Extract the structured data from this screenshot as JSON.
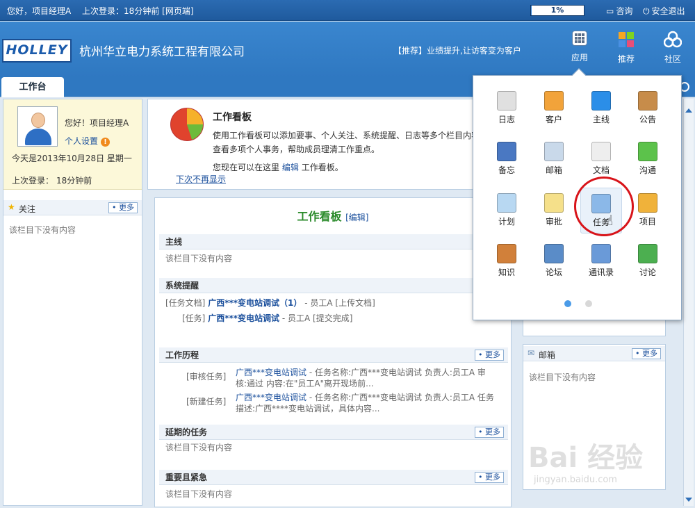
{
  "topbar": {
    "greeting": "您好，项目经理A",
    "last_login": "上次登录：18分钟前 [网页端]",
    "progress_text": "1%",
    "progress_value": 0.01,
    "consult": "咨询",
    "logout": "安全退出"
  },
  "header": {
    "logo": "HOLLEY",
    "company": "杭州华立电力系统工程有限公司",
    "promo": "【推荐】业绩提升,让访客变为客户",
    "nav": [
      {
        "label": "应用",
        "icon": "grid-icon"
      },
      {
        "label": "推荐",
        "icon": "recommend-icon"
      },
      {
        "label": "社区",
        "icon": "community-icon"
      }
    ]
  },
  "tabs": {
    "workbench": "工作台"
  },
  "user": {
    "hello": "您好！项目经理A",
    "settings": "个人设置",
    "settings_badge": "!",
    "today": "今天是2013年10月28日 星期一",
    "last_login_label": "上次登录：",
    "last_login_value": "18分钟前"
  },
  "follow": {
    "title": "关注",
    "more": "更多",
    "empty": "该栏目下没有内容"
  },
  "guide": {
    "title": "工作看板",
    "desc1": "使用工作看板可以添加要事、个人关注、系统提醒、日志等多个栏目内容，",
    "desc2": "查看多项个人事务，帮助成员理清工作重点。",
    "desc3_pre": "您现在可以在这里",
    "desc3_link": "编辑",
    "desc3_post": "工作看板。",
    "no_more": "下次不再显示"
  },
  "board": {
    "title": "工作看板",
    "edit": "[编辑]",
    "mainline": {
      "title": "主线",
      "empty": "该栏目下没有内容"
    },
    "reminders": {
      "title": "系统提醒",
      "items": [
        {
          "label": "[任务文档]",
          "link": "广西***变电站调试（1）",
          "note": "- 员工A [上传文档]"
        },
        {
          "label": "[任务]",
          "link": "广西***变电站调试",
          "note": "- 员工A [提交完成]"
        }
      ]
    },
    "history": {
      "title": "工作历程",
      "more": "更多",
      "items": [
        {
          "label": "[审核任务]",
          "link": "广西***变电站调试",
          "line1": "- 任务名称:广西***变电站调试 负责人:员工A 审",
          "line2": "核:通过 内容:在\"员工A\"离开现场前..."
        },
        {
          "label": "[新建任务]",
          "link": "广西***变电站调试",
          "line1": "- 任务名称:广西***变电站调试 负责人:员工A 任务",
          "line2": "描述:广西****变电站调试，具体内容..."
        }
      ]
    },
    "delayed": {
      "title": "延期的任务",
      "more": "更多",
      "empty": "该栏目下没有内容"
    },
    "urgent": {
      "title": "重要且紧急",
      "more": "更多",
      "empty": "该栏目下没有内容"
    }
  },
  "mailbox": {
    "title": "邮箱",
    "more": "更多",
    "empty": "该栏目下没有内容"
  },
  "apps": [
    {
      "label": "日志",
      "icon": "calendar-icon",
      "color": "#e0e0e0"
    },
    {
      "label": "客户",
      "icon": "customers-icon",
      "color": "#f2a33a"
    },
    {
      "label": "主线",
      "icon": "mainline-icon",
      "color": "#2b8ee8"
    },
    {
      "label": "公告",
      "icon": "clipboard-icon",
      "color": "#c78c4a"
    },
    {
      "label": "备忘",
      "icon": "notebook-icon",
      "color": "#4a78c2"
    },
    {
      "label": "邮箱",
      "icon": "mail-icon",
      "color": "#c9d9ea"
    },
    {
      "label": "文档",
      "icon": "document-icon",
      "color": "#eeeeee"
    },
    {
      "label": "沟通",
      "icon": "chat-icon",
      "color": "#5cc24b"
    },
    {
      "label": "计划",
      "icon": "plan-table-icon",
      "color": "#b8d8f2"
    },
    {
      "label": "审批",
      "icon": "approval-icon",
      "color": "#f5e08a"
    },
    {
      "label": "任务",
      "icon": "task-icon",
      "color": "#8bb8e8"
    },
    {
      "label": "项目",
      "icon": "gears-icon",
      "color": "#f0b23a"
    },
    {
      "label": "知识",
      "icon": "books-icon",
      "color": "#d1803a"
    },
    {
      "label": "论坛",
      "icon": "forum-icon",
      "color": "#5a8cc8"
    },
    {
      "label": "通讯录",
      "icon": "contacts-icon",
      "color": "#6a9ad8"
    },
    {
      "label": "讨论",
      "icon": "discuss-icon",
      "color": "#4caf50"
    }
  ],
  "watermark": {
    "main": "Bai 经验",
    "sub": "jingyan.baidu.com"
  }
}
